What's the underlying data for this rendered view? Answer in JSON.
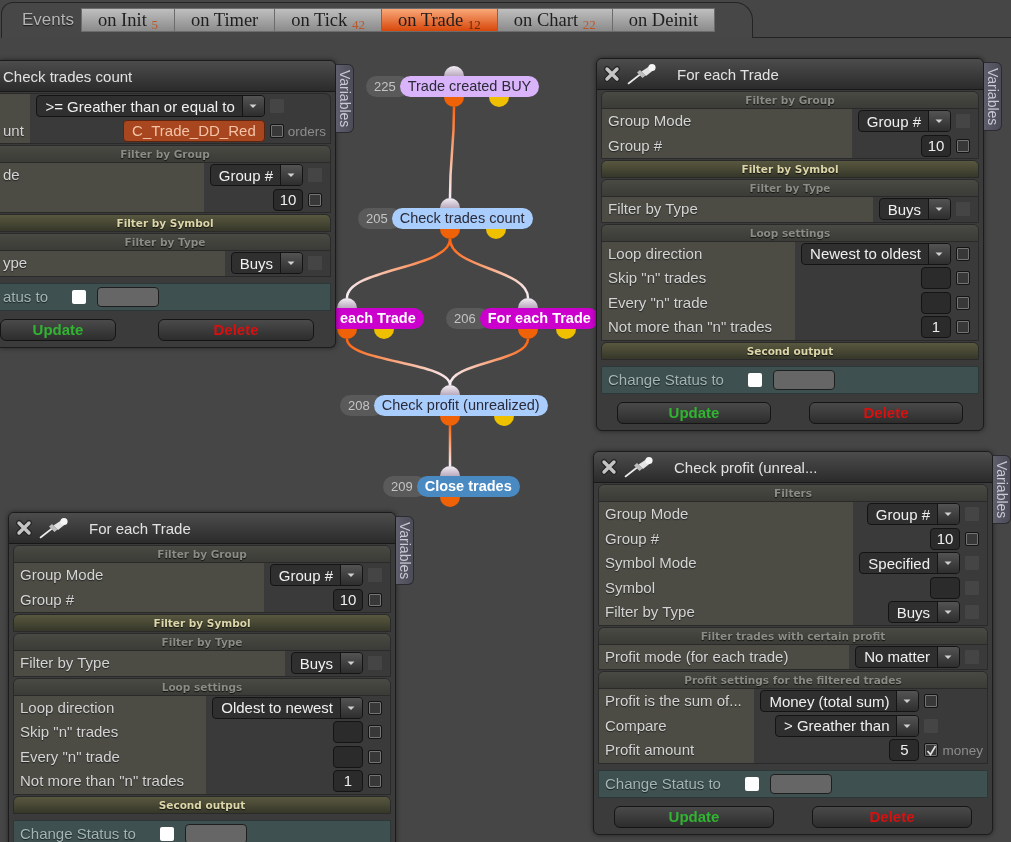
{
  "header": {
    "title": "Events"
  },
  "tabs": [
    {
      "label": "on Init",
      "count": "5",
      "selected": false
    },
    {
      "label": "on Timer",
      "selected": false
    },
    {
      "label": "on Tick",
      "count": "42",
      "selected": false
    },
    {
      "label": "on Trade",
      "count": "12",
      "selected": true
    },
    {
      "label": "on Chart",
      "count": "22",
      "selected": false
    },
    {
      "label": "on Deinit",
      "selected": false
    }
  ],
  "graph": {
    "nodes": [
      {
        "id": "225",
        "label": "Trade created BUY",
        "color": "#dab4fa",
        "second_output": true
      },
      {
        "id": "205",
        "label": "Check trades count",
        "color": "#a9cdfd",
        "second_output": true
      },
      {
        "label": "each Trade",
        "color": "#cc00cc",
        "second_output": true
      },
      {
        "id": "206",
        "label": "For each Trade",
        "color": "#cc00cc",
        "second_output": true
      },
      {
        "id": "208",
        "label": "Check profit (unrealized)",
        "color": "#a9cdfd",
        "second_output": true
      },
      {
        "id": "209",
        "label": "Close trades",
        "color": "#4a8ac2",
        "second_output": false
      }
    ]
  },
  "panels": [
    {
      "title": "Check trades count",
      "title_icons": false,
      "side_tab": "Variables",
      "sections": [
        {
          "expanded": true,
          "rows": [
            {
              "kind": "dropdown",
              "value": ">= Greather than or equal to",
              "checked": false,
              "disabled": true
            },
            {
              "label": "unt",
              "kind": "variable",
              "value": "C_Trade_DD_Red",
              "checked": false,
              "disabled": false,
              "unit": "orders"
            }
          ]
        },
        {
          "title": "Filter by Group",
          "expanded": true,
          "rows": [
            {
              "label": "de",
              "kind": "dropdown",
              "value": "Group #",
              "checked": false,
              "disabled": true
            },
            {
              "kind": "field",
              "value": "10",
              "checked": false,
              "disabled": false
            }
          ]
        },
        {
          "title": "Filter by Symbol",
          "expanded": false
        },
        {
          "title": "Filter by Type",
          "expanded": true,
          "rows": [
            {
              "label": "ype",
              "kind": "dropdown",
              "value": "Buys",
              "checked": false,
              "disabled": true
            }
          ]
        }
      ],
      "status": {
        "label": "atus to",
        "checked": false
      },
      "buttons": [
        {
          "label": "Update",
          "kind": "update"
        },
        {
          "label": "Delete",
          "kind": "delete"
        }
      ]
    },
    {
      "title": "For each Trade",
      "title_icons": true,
      "side_tab": "Variables",
      "sections": [
        {
          "title": "Filter by Group",
          "expanded": true,
          "rows": [
            {
              "label": "Group Mode",
              "kind": "dropdown",
              "value": "Group #",
              "checked": false,
              "disabled": true
            },
            {
              "label": "Group #",
              "kind": "field",
              "value": "10",
              "checked": false,
              "disabled": false
            }
          ]
        },
        {
          "title": "Filter by Symbol",
          "expanded": false
        },
        {
          "title": "Filter by Type",
          "expanded": true,
          "rows": [
            {
              "label": "Filter by Type",
              "kind": "dropdown",
              "value": "Buys",
              "checked": false,
              "disabled": true
            }
          ]
        },
        {
          "title": "Loop settings",
          "expanded": true,
          "rows": [
            {
              "label": "Loop direction",
              "kind": "dropdown",
              "value": "Newest to oldest",
              "checked": false,
              "disabled": false
            },
            {
              "label": "Skip \"n\" trades",
              "kind": "field",
              "checked": false,
              "disabled": false
            },
            {
              "label": "Every \"n\" trade",
              "kind": "field",
              "checked": false,
              "disabled": false
            },
            {
              "label": "Not more than \"n\" trades",
              "kind": "field",
              "value": "1",
              "checked": false,
              "disabled": false
            }
          ]
        },
        {
          "title": "Second output",
          "expanded": false
        }
      ],
      "status": {
        "label": "Change Status to",
        "checked": false
      },
      "buttons": [
        {
          "label": "Update",
          "kind": "update"
        },
        {
          "label": "Delete",
          "kind": "delete"
        }
      ]
    },
    {
      "title": "For each Trade",
      "title_icons": true,
      "side_tab": "Variables",
      "sections": [
        {
          "title": "Filter by Group",
          "expanded": true,
          "rows": [
            {
              "label": "Group Mode",
              "kind": "dropdown",
              "value": "Group #",
              "checked": false,
              "disabled": true
            },
            {
              "label": "Group #",
              "kind": "field",
              "value": "10",
              "checked": false,
              "disabled": false
            }
          ]
        },
        {
          "title": "Filter by Symbol",
          "expanded": false
        },
        {
          "title": "Filter by Type",
          "expanded": true,
          "rows": [
            {
              "label": "Filter by Type",
              "kind": "dropdown",
              "value": "Buys",
              "checked": false,
              "disabled": true
            }
          ]
        },
        {
          "title": "Loop settings",
          "expanded": true,
          "rows": [
            {
              "label": "Loop direction",
              "kind": "dropdown",
              "value": "Oldest to newest",
              "checked": false,
              "disabled": false
            },
            {
              "label": "Skip \"n\" trades",
              "kind": "field",
              "checked": false,
              "disabled": false
            },
            {
              "label": "Every \"n\" trade",
              "kind": "field",
              "checked": false,
              "disabled": false
            },
            {
              "label": "Not more than \"n\" trades",
              "kind": "field",
              "value": "1",
              "checked": false,
              "disabled": false
            }
          ]
        },
        {
          "title": "Second output",
          "expanded": false
        }
      ],
      "status": {
        "label": "Change Status to",
        "checked": false
      }
    },
    {
      "title": "Check profit (unreal...",
      "title_icons": true,
      "side_tab": "Variables",
      "sections": [
        {
          "title": "Filters",
          "expanded": true,
          "rows": [
            {
              "label": "Group Mode",
              "kind": "dropdown",
              "value": "Group #",
              "checked": false,
              "disabled": true
            },
            {
              "label": "Group #",
              "kind": "field",
              "value": "10",
              "checked": false,
              "disabled": false
            },
            {
              "label": "Symbol Mode",
              "kind": "dropdown",
              "value": "Specified",
              "checked": false,
              "disabled": true
            },
            {
              "label": "Symbol",
              "kind": "field",
              "checked": false,
              "disabled": true
            },
            {
              "label": "Filter by Type",
              "kind": "dropdown",
              "value": "Buys",
              "checked": false,
              "disabled": true
            }
          ]
        },
        {
          "title": "Filter trades with certain profit",
          "expanded": true,
          "rows": [
            {
              "label": "Profit mode (for each trade)",
              "kind": "dropdown",
              "value": "No matter",
              "checked": false,
              "disabled": true
            }
          ]
        },
        {
          "title": "Profit settings for the filtered trades",
          "expanded": true,
          "rows": [
            {
              "label": "Profit is the sum of...",
              "kind": "dropdown",
              "value": "Money (total sum)",
              "checked": false,
              "disabled": false
            },
            {
              "label": "Compare",
              "kind": "dropdown",
              "value": "> Greather than",
              "checked": false,
              "disabled": true
            },
            {
              "label": "Profit amount",
              "kind": "field",
              "value": "5",
              "checked": true,
              "disabled": false,
              "unit": "money"
            }
          ]
        }
      ],
      "status": {
        "label": "Change Status to",
        "checked": false
      },
      "buttons": [
        {
          "label": "Update",
          "kind": "update"
        },
        {
          "label": "Delete",
          "kind": "delete"
        }
      ]
    }
  ]
}
